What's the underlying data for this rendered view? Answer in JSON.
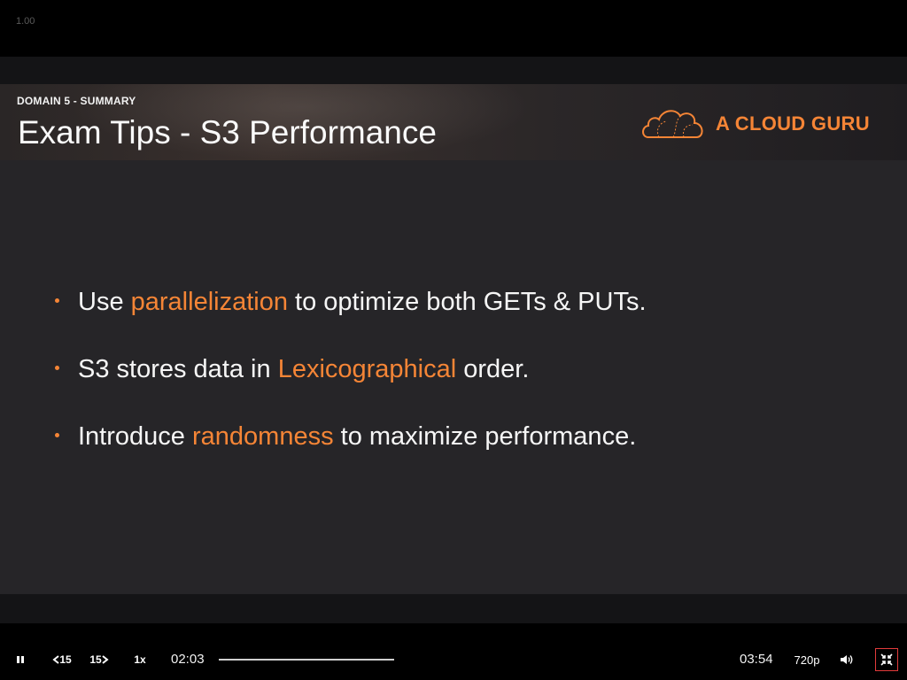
{
  "overlay": {
    "speed_readout": "1.00"
  },
  "slide": {
    "domain_label": "DOMAIN 5 - SUMMARY",
    "title": "Exam Tips - S3 Performance",
    "logo_text": "A CLOUD GURU",
    "bullets": [
      {
        "before": "Use ",
        "highlight": "parallelization",
        "after": " to optimize both GETs & PUTs."
      },
      {
        "before": "S3 stores data in ",
        "highlight": "Lexicographical",
        "after": " order."
      },
      {
        "before": "Introduce ",
        "highlight": "randomness",
        "after": " to maximize performance."
      }
    ],
    "colors": {
      "accent": "#f58536",
      "body_bg": "#262528",
      "text": "#f6f6f6"
    }
  },
  "controls": {
    "rewind_label": "15",
    "forward_label": "15",
    "speed_label": "1x",
    "current_time": "02:03",
    "duration": "03:54",
    "quality": "720p",
    "progress_fraction": 0.0,
    "icons": [
      "pause-icon",
      "rewind-15-icon",
      "forward-15-icon",
      "volume-icon",
      "exit-fullscreen-icon"
    ]
  }
}
